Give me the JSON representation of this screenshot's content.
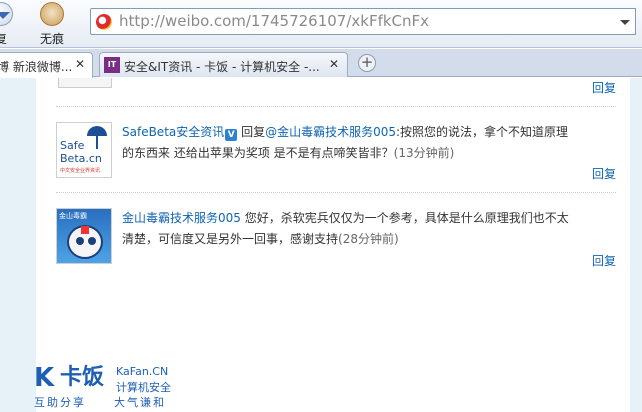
{
  "toolbar": {
    "restore_label": "复",
    "nothing_label": "无痕",
    "url_domain": "http://weibo.com",
    "url_path": "/1745726107/xkFfkCnFx"
  },
  "tabs": [
    {
      "label": "博 新浪微博...",
      "close": "✕"
    },
    {
      "label": "安全&IT资讯 - 卡饭 - 计算机安全 -...",
      "icon_text": "IT",
      "close": "✕"
    }
  ],
  "new_tab": "+",
  "reply_label": "回复",
  "comments": [
    {
      "name": "SafeBeta安全资讯",
      "verified_badge": "V",
      "prefix": " 回复",
      "mention": "@金山毒霸技术服务005",
      "text": ":按照您的说法，拿个不知道原理的东西来 还给出苹果为奖项 是不是有点啼笑皆非？",
      "time": "(13分钟前)",
      "avatar": {
        "text": "Safe\nBeta.cn",
        "sub": "中文安全业界资讯"
      }
    },
    {
      "name": "金山毒霸技术服务005",
      "text": " 您好，杀软宪兵仅仅为一个参考，具体是什么原理我们也不太清楚，可信度又是另外一回事，感谢支持",
      "time": "(28分钟前)",
      "avatar": {
        "text": "金山毒霸"
      }
    }
  ],
  "watermark": {
    "logo_k": "K",
    "brand": "卡饭",
    "en": "KaFan.CN",
    "cn": "计算机安全",
    "slogan_left": "互助分享",
    "slogan_right": "大气谦和"
  },
  "colors": {
    "link": "#0f64b0",
    "sidebar": "#e7f2f8",
    "brand": "#1e5fb4"
  }
}
